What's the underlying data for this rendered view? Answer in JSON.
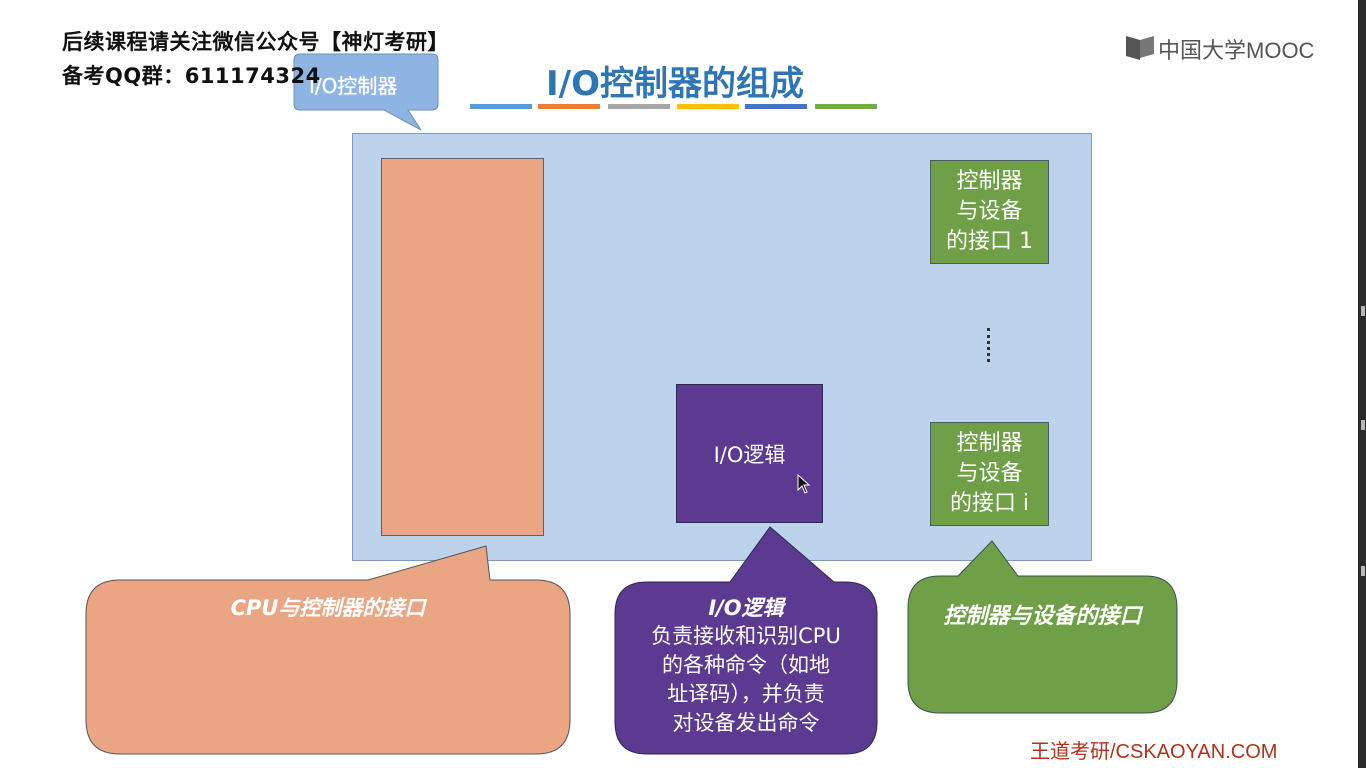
{
  "header": {
    "notice_line1": "后续课程请关注微信公众号【神灯考研】",
    "notice_line2": "备考QQ群：611174324"
  },
  "logo": {
    "text": "中国大学MOOC"
  },
  "slide": {
    "title": "I/O控制器的组成",
    "title_bar_colors": [
      "#5b9bd5",
      "#ed7d31",
      "#a5a5a5",
      "#ffc000",
      "#4472c4",
      "#70ad47"
    ]
  },
  "diagram": {
    "container_callout": "I/O控制器",
    "device_interface_1": [
      "控制器",
      "与设备",
      "的接口 1"
    ],
    "device_interface_i": [
      "控制器",
      "与设备",
      "的接口 i"
    ],
    "io_logic_box": "I/O逻辑"
  },
  "callouts": {
    "cpu_interface": {
      "title": "CPU与控制器的接口"
    },
    "io_logic": {
      "title": "I/O逻辑",
      "body": [
        "负责接收和识别CPU",
        "的各种命令（如地",
        "址译码），并负责",
        "对设备发出命令"
      ]
    },
    "device_interface": {
      "title": "控制器与设备的接口"
    }
  },
  "colors": {
    "container": "#bcd3eb",
    "cpu_interface": "#eaa683",
    "device_interface": "#6fa047",
    "io_logic": "#5c3a91",
    "title": "#2e75b6",
    "footer": "#b0321a"
  },
  "footer": {
    "text": "王道考研/CSKAOYAN.COM"
  }
}
